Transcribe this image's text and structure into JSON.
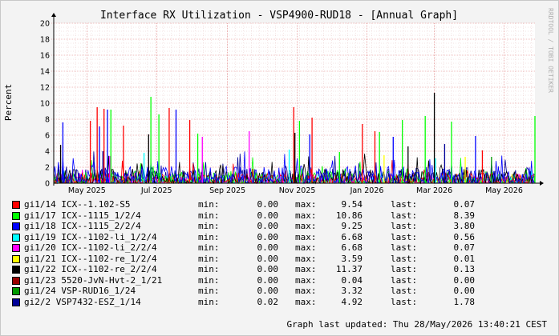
{
  "chart_data": {
    "type": "line",
    "title": "Interface RX Utilization - VSP4900-RUD18 - [Annual Graph]",
    "ylabel": "Percent",
    "xlabel": "",
    "ylim": [
      0,
      20
    ],
    "yticks": [
      0,
      2,
      4,
      6,
      8,
      10,
      12,
      14,
      16,
      18,
      20
    ],
    "xticks": [
      "May 2025",
      "Jul 2025",
      "Sep 2025",
      "Nov 2025",
      "Jan 2026",
      "Mar 2026",
      "May 2026"
    ],
    "xrange": [
      "2025-04-02",
      "2026-05-28"
    ],
    "grid": true,
    "watermark": "RRDTOOL / TOBI OETIKER",
    "series": [
      {
        "name": "gi1/14 ICX--1.102-S5",
        "color": "#ff0000",
        "min": "0.00",
        "max": "9.54",
        "last": "0.07"
      },
      {
        "name": "gi1/17 ICX--1115_1/2/4",
        "color": "#00ff00",
        "min": "0.00",
        "max": "10.86",
        "last": "8.39"
      },
      {
        "name": "gi1/18 ICX--1115_2/2/4",
        "color": "#0000ff",
        "min": "0.00",
        "max": "9.25",
        "last": "3.80"
      },
      {
        "name": "gi1/19 ICX--1102-li_1/2/4",
        "color": "#00ffff",
        "min": "0.00",
        "max": "6.68",
        "last": "0.56"
      },
      {
        "name": "gi1/20 ICX--1102-li_2/2/4",
        "color": "#ff00ff",
        "min": "0.00",
        "max": "6.68",
        "last": "0.07"
      },
      {
        "name": "gi1/21 ICX--1102-re_1/2/4",
        "color": "#ffff00",
        "min": "0.00",
        "max": "3.59",
        "last": "0.01"
      },
      {
        "name": "gi1/22 ICX--1102-re_2/2/4",
        "color": "#000000",
        "min": "0.00",
        "max": "11.37",
        "last": "0.13"
      },
      {
        "name": "gi1/23 5520-JvN-Hvt-2_1/21",
        "color": "#990000",
        "min": "0.00",
        "max": "0.04",
        "last": "0.00"
      },
      {
        "name": "gi1/24 VSP-RUD16_1/24",
        "color": "#009900",
        "min": "0.00",
        "max": "3.32",
        "last": "0.00"
      },
      {
        "name": "gi2/2 VSP7432-ESZ_1/14",
        "color": "#000099",
        "min": "0.02",
        "max": "4.92",
        "last": "1.78"
      }
    ],
    "spikes": [
      {
        "series": 0,
        "x": "2025-05-04",
        "y": 7.8
      },
      {
        "series": 0,
        "x": "2025-05-10",
        "y": 9.5
      },
      {
        "series": 0,
        "x": "2025-05-16",
        "y": 9.3
      },
      {
        "series": 0,
        "x": "2025-06-02",
        "y": 7.2
      },
      {
        "series": 0,
        "x": "2025-07-12",
        "y": 9.4
      },
      {
        "series": 0,
        "x": "2025-07-30",
        "y": 7.9
      },
      {
        "series": 0,
        "x": "2025-10-29",
        "y": 9.5
      },
      {
        "series": 0,
        "x": "2025-11-14",
        "y": 8.2
      },
      {
        "series": 0,
        "x": "2025-12-28",
        "y": 7.4
      },
      {
        "series": 0,
        "x": "2026-01-08",
        "y": 6.5
      },
      {
        "series": 0,
        "x": "2026-04-12",
        "y": 4.1
      },
      {
        "series": 1,
        "x": "2025-05-22",
        "y": 9.2
      },
      {
        "series": 1,
        "x": "2025-06-26",
        "y": 10.8
      },
      {
        "series": 1,
        "x": "2025-07-03",
        "y": 8.6
      },
      {
        "series": 1,
        "x": "2025-08-06",
        "y": 6.2
      },
      {
        "series": 1,
        "x": "2025-11-03",
        "y": 7.8
      },
      {
        "series": 1,
        "x": "2025-12-08",
        "y": 3.9
      },
      {
        "series": 1,
        "x": "2026-01-12",
        "y": 6.4
      },
      {
        "series": 1,
        "x": "2026-02-01",
        "y": 7.9
      },
      {
        "series": 1,
        "x": "2026-02-21",
        "y": 8.4
      },
      {
        "series": 1,
        "x": "2026-03-16",
        "y": 7.7
      },
      {
        "series": 1,
        "x": "2026-05-28",
        "y": 8.4
      },
      {
        "series": 2,
        "x": "2025-04-10",
        "y": 7.6
      },
      {
        "series": 2,
        "x": "2025-05-12",
        "y": 7.1
      },
      {
        "series": 2,
        "x": "2025-05-19",
        "y": 9.2
      },
      {
        "series": 2,
        "x": "2025-07-18",
        "y": 9.2
      },
      {
        "series": 2,
        "x": "2025-11-12",
        "y": 6.1
      },
      {
        "series": 2,
        "x": "2026-01-24",
        "y": 5.8
      },
      {
        "series": 2,
        "x": "2026-04-06",
        "y": 5.9
      },
      {
        "series": 3,
        "x": "2025-10-25",
        "y": 4.2
      },
      {
        "series": 3,
        "x": "2025-06-20",
        "y": 3.8
      },
      {
        "series": 3,
        "x": "2026-03-02",
        "y": 3.1
      },
      {
        "series": 4,
        "x": "2025-09-20",
        "y": 6.5
      },
      {
        "series": 4,
        "x": "2025-08-10",
        "y": 5.8
      },
      {
        "series": 4,
        "x": "2025-05-21",
        "y": 3.4
      },
      {
        "series": 5,
        "x": "2026-01-16",
        "y": 3.5
      },
      {
        "series": 5,
        "x": "2026-03-28",
        "y": 3.3
      },
      {
        "series": 6,
        "x": "2026-03-01",
        "y": 11.3
      },
      {
        "series": 6,
        "x": "2025-06-24",
        "y": 6.1
      },
      {
        "series": 6,
        "x": "2025-04-08",
        "y": 4.8
      },
      {
        "series": 6,
        "x": "2025-10-30",
        "y": 6.3
      },
      {
        "series": 6,
        "x": "2026-02-06",
        "y": 4.6
      },
      {
        "series": 8,
        "x": "2026-04-20",
        "y": 3.3
      },
      {
        "series": 9,
        "x": "2026-03-10",
        "y": 4.9
      },
      {
        "series": 9,
        "x": "2025-05-15",
        "y": 4.0
      }
    ]
  },
  "legend_labels": {
    "min": "min:",
    "max": "max:",
    "last": "last:"
  },
  "footer": "Graph last updated: Thu 28/May/2026 13:40:21 CEST"
}
